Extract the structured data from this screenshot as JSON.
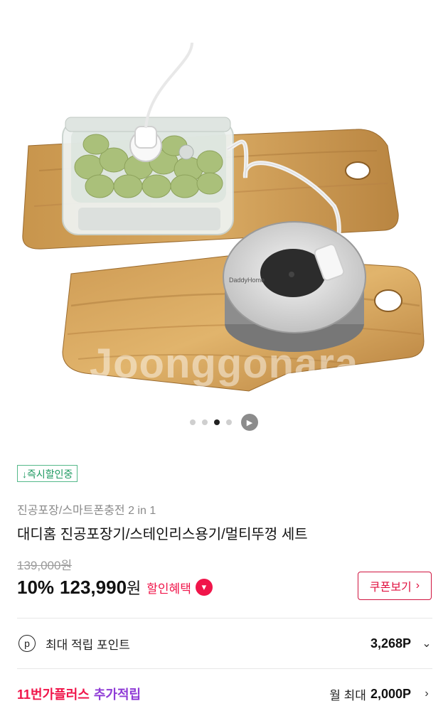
{
  "gallery": {
    "watermark": "Joonggonara",
    "device_brand": "DaddyHome",
    "dot_count": 4,
    "active_dot": 2,
    "play_icon": "play-icon"
  },
  "product": {
    "instant_discount_badge": "↓즉시할인중",
    "category": "진공포장/스마트폰충전 2 in 1",
    "title": "대디홈 진공포장기/스테인리스용기/멀티뚜껑 세트",
    "original_price": "139,000원",
    "discount_rate": "10%",
    "sale_price": "123,990",
    "sale_price_unit": "원",
    "benefit_label": "할인혜택",
    "coupon_button": "쿠폰보기"
  },
  "points": {
    "icon_letter": "p",
    "label": "최대 적립 포인트",
    "value": "3,268P"
  },
  "plus": {
    "brand": "11번가플러스",
    "extra": "추가적립",
    "prefix": "월 최대",
    "value": "2,000P"
  },
  "colors": {
    "accent": "#f0154a",
    "badge_green": "#1f9a62",
    "purple": "#8f3bd6"
  }
}
